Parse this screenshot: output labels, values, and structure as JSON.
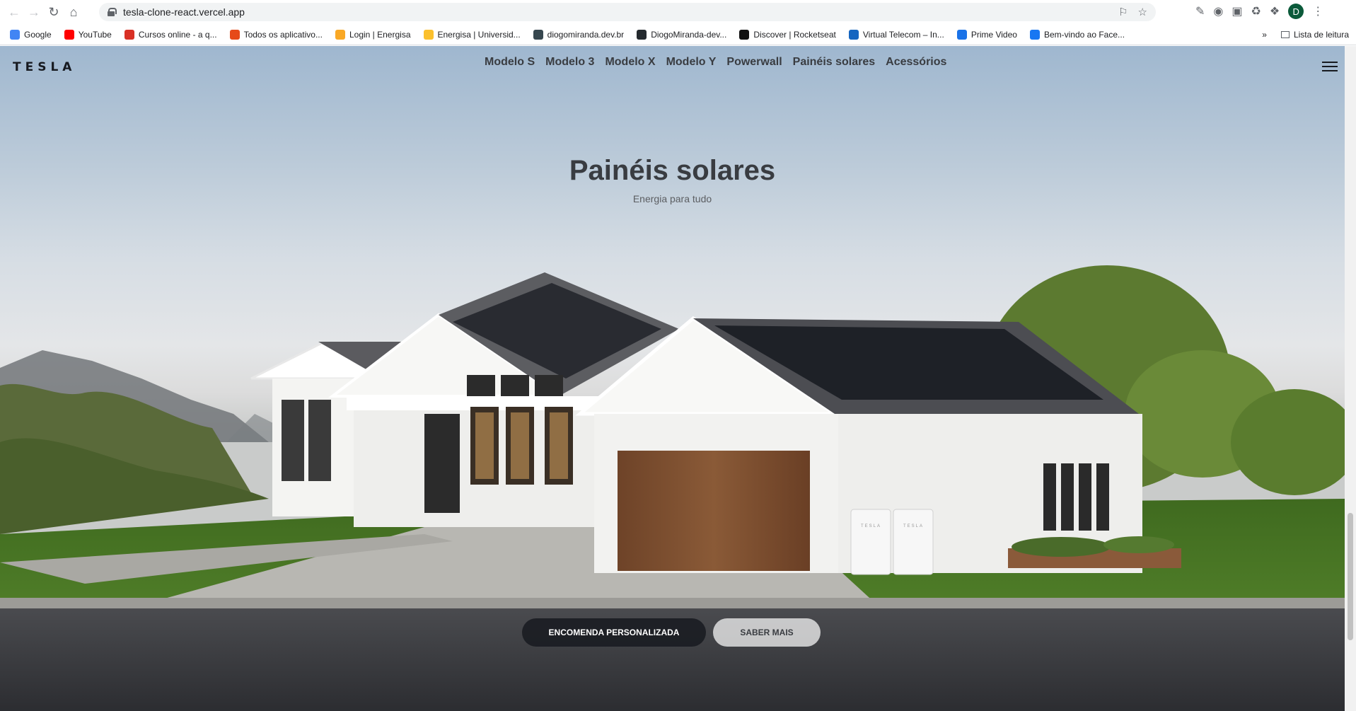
{
  "browser": {
    "url": "tesla-clone-react.vercel.app",
    "profile_initial": "D",
    "bookmarks": [
      {
        "label": "Google",
        "color": "#4285f4"
      },
      {
        "label": "YouTube",
        "color": "#ff0000"
      },
      {
        "label": "Cursos online - a q...",
        "color": "#d93025"
      },
      {
        "label": "Todos os aplicativo...",
        "color": "#e64a19"
      },
      {
        "label": "Login | Energisa",
        "color": "#f9a825"
      },
      {
        "label": "Energisa | Universid...",
        "color": "#fbc02d"
      },
      {
        "label": "diogomiranda.dev.br",
        "color": "#37474f"
      },
      {
        "label": "DiogoMiranda-dev...",
        "color": "#24292e"
      },
      {
        "label": "Discover | Rocketseat",
        "color": "#111111"
      },
      {
        "label": "Virtual Telecom – In...",
        "color": "#1565c0"
      },
      {
        "label": "Prime Video",
        "color": "#1a73e8"
      },
      {
        "label": "Bem-vindo ao Face...",
        "color": "#1877f2"
      }
    ],
    "reading_list": "Lista de leitura",
    "more_bookmarks": "»"
  },
  "site": {
    "logo": "TESLA",
    "menu": [
      "Modelo S",
      "Modelo 3",
      "Modelo X",
      "Modelo Y",
      "Powerwall",
      "Painéis solares",
      "Acessórios"
    ]
  },
  "hero": {
    "title": "Painéis solares",
    "subtitle": "Energia para tudo",
    "primary_button": "Encomenda personalizada",
    "secondary_button": "Saber mais",
    "powerwall_label": "TESLA"
  },
  "colors": {
    "primary_button_bg": "#171a20",
    "secondary_button_bg": "#f4f4f4",
    "text_dark": "#393c41"
  }
}
